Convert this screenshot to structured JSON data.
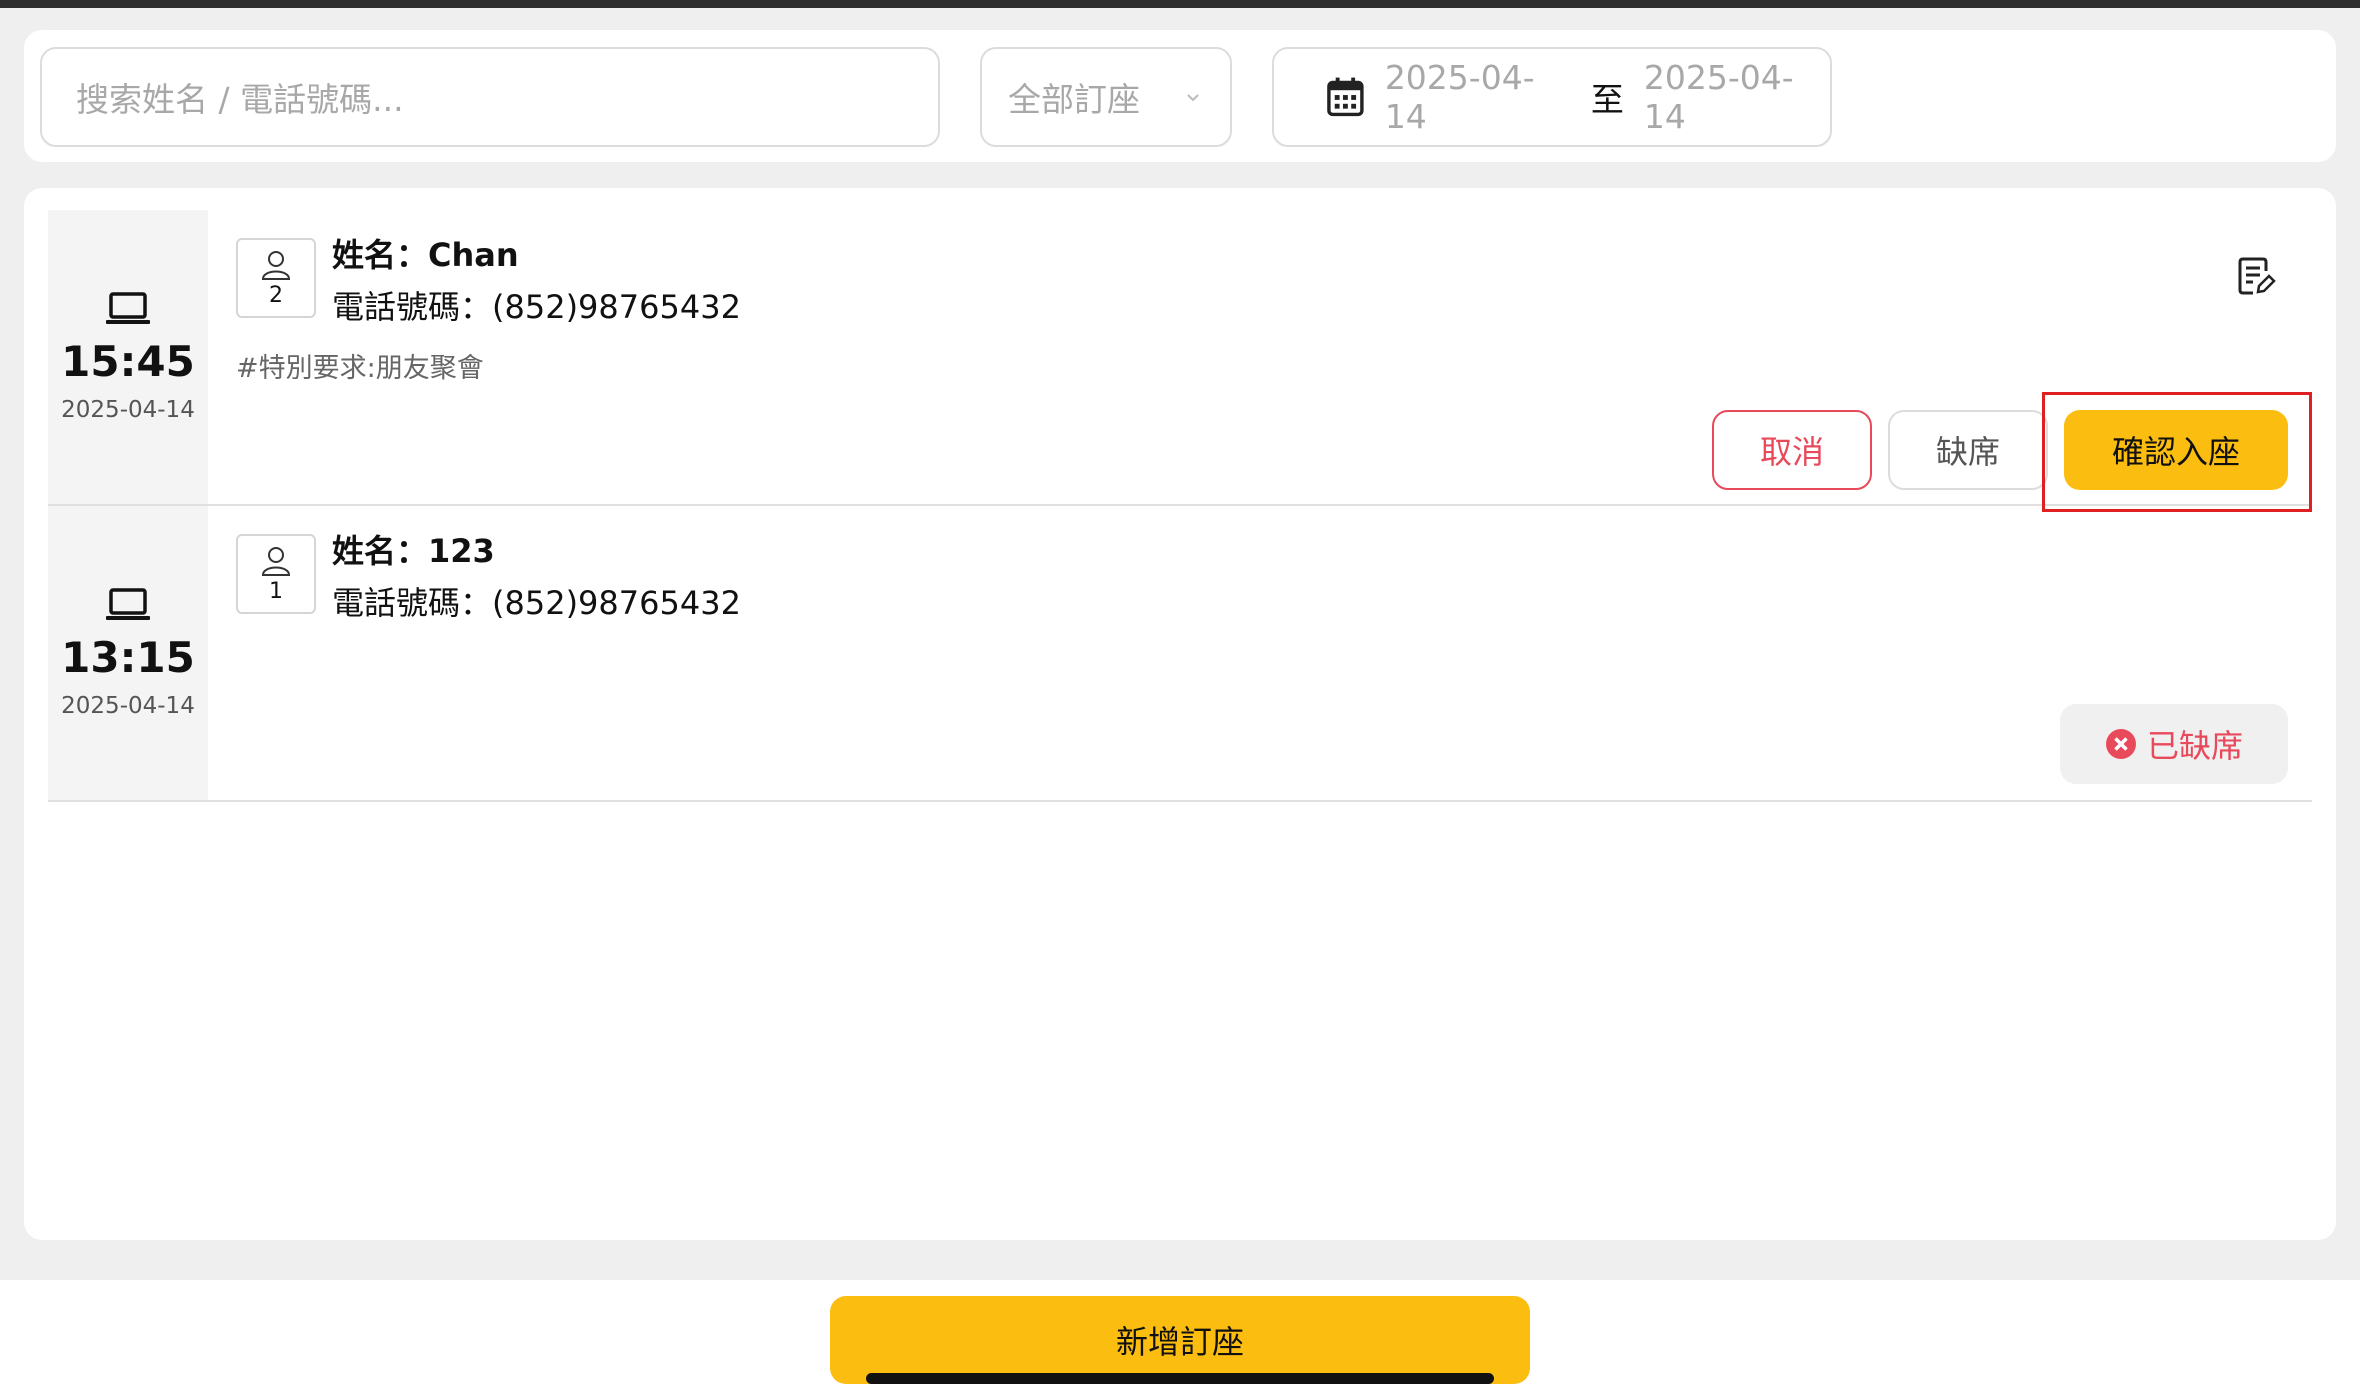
{
  "filters": {
    "search_placeholder": "搜索姓名 / 電話號碼...",
    "reservation_type": "全部訂座",
    "date_from": "2025-04-14",
    "date_separator": "至",
    "date_to": "2025-04-14"
  },
  "reservations": [
    {
      "time": "15:45",
      "date": "2025-04-14",
      "party_size": "2",
      "name": "姓名：Chan",
      "phone": "電話號碼：(852)98765432",
      "note": "#特別要求:朋友聚會",
      "actions": {
        "cancel": "取消",
        "no_show": "缺席",
        "confirm": "確認入座"
      }
    },
    {
      "time": "13:15",
      "date": "2025-04-14",
      "party_size": "1",
      "name": "姓名：123",
      "phone": "電話號碼：(852)98765432",
      "status": "已缺席"
    }
  ],
  "footer": {
    "add_label": "新增訂座"
  },
  "colors": {
    "accent": "#fbbd10",
    "danger": "#e8495b",
    "highlight": "#e02020"
  }
}
